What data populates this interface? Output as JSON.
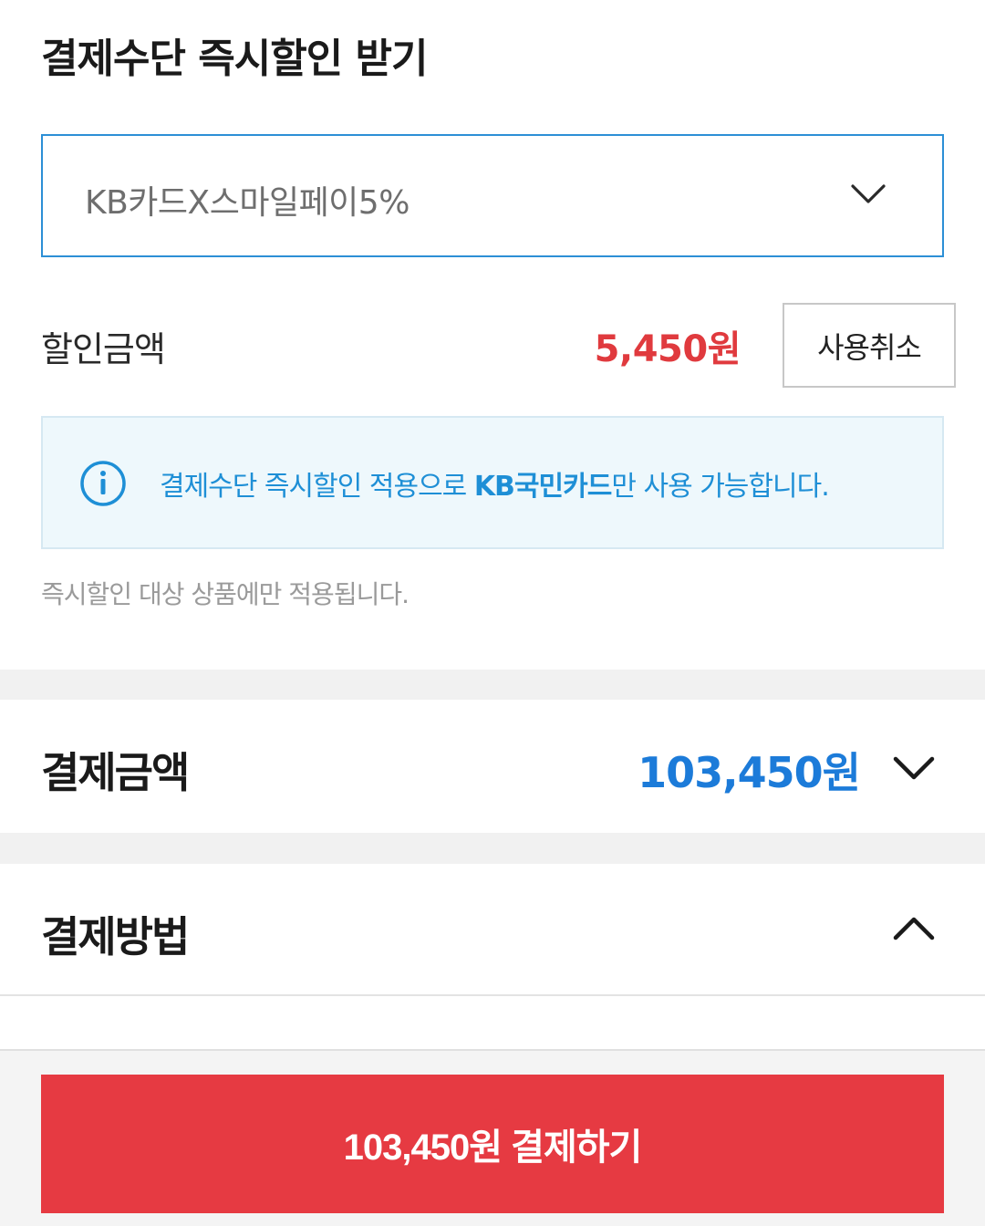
{
  "discount": {
    "title": "결제수단 즉시할인 받기",
    "select_value": "KB카드X스마일페이5%",
    "amount_label": "할인금액",
    "amount_value": "5,450원",
    "cancel_label": "사용취소",
    "info_pre": "결제수단 즉시할인 적용으로 ",
    "info_bold": "KB국민카드",
    "info_post": "만 사용 가능합니다.",
    "note": "즉시할인 대상 상품에만 적용됩니다."
  },
  "total": {
    "label": "결제금액",
    "amount": "103,450원"
  },
  "method": {
    "label": "결제방법"
  },
  "pay_button": {
    "label": "103,450원 결제하기"
  },
  "colors": {
    "accent_red": "#e63a42",
    "amount_blue": "#1c7bd9",
    "info_blue": "#1e8fd6",
    "select_border": "#2c8fd6"
  },
  "icons": {
    "select_chevron": "chevron-down-icon",
    "info": "info-icon",
    "total_toggle": "chevron-down-icon",
    "method_toggle": "chevron-up-icon"
  }
}
